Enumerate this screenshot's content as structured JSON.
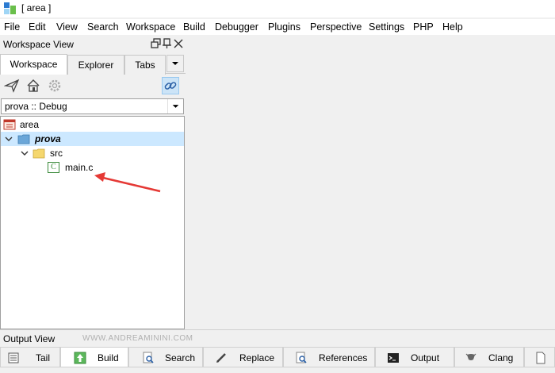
{
  "window": {
    "title": "[ area ]"
  },
  "menu": [
    "File",
    "Edit",
    "View",
    "Search",
    "Workspace",
    "Build",
    "Debugger",
    "Plugins",
    "Perspective",
    "Settings",
    "PHP",
    "Help"
  ],
  "workspace_view": {
    "title": "Workspace View",
    "tabs": [
      "Workspace",
      "Explorer",
      "Tabs"
    ],
    "active_tab": "Workspace",
    "configuration": "prova :: Debug",
    "tree": {
      "workspace": "area",
      "project": "prova",
      "folder": "src",
      "file": "main.c",
      "file_icon_letter": "C"
    }
  },
  "output_view": {
    "title": "Output View",
    "watermark": "WWW.ANDREAMININI.COM",
    "tabs": [
      "Tail",
      "Build",
      "Search",
      "Replace",
      "References",
      "Output",
      "Clang"
    ],
    "active_tab": "Build"
  },
  "colors": {
    "selection": "#cce8ff",
    "annotation_arrow": "#e53935",
    "folder": "#f5d76e",
    "project": "#6aa6d8"
  }
}
